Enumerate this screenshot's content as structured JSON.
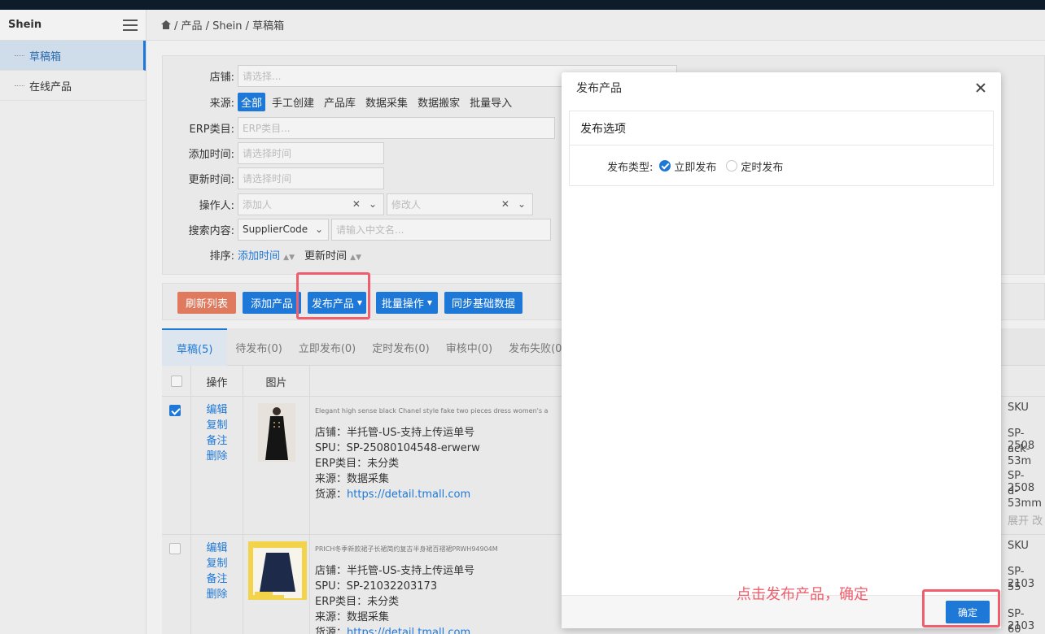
{
  "sidebar": {
    "title": "Shein",
    "items": [
      {
        "label": "草稿箱"
      },
      {
        "label": "在线产品"
      }
    ]
  },
  "breadcrumb": {
    "path": "/ 产品 / Shein / 草稿箱"
  },
  "filters": {
    "store_label": "店铺:",
    "store_placeholder": "请选择...",
    "source_label": "来源:",
    "sources": [
      "全部",
      "手工创建",
      "产品库",
      "数据采集",
      "数据搬家",
      "批量导入"
    ],
    "erp_label": "ERP类目:",
    "erp_placeholder": "ERP类目...",
    "added_label": "添加时间:",
    "added_placeholder": "请选择时间",
    "updated_label": "更新时间:",
    "updated_placeholder": "请选择时间",
    "operator_label": "操作人:",
    "adder_placeholder": "添加人",
    "modifier_placeholder": "修改人",
    "search_label": "搜索内容:",
    "search_type": "SupplierCode",
    "search_placeholder": "请输入中文名...",
    "sort_label": "排序:",
    "sort_added": "添加时间",
    "sort_updated": "更新时间"
  },
  "toolbar": {
    "refresh": "刷新列表",
    "add": "添加产品",
    "publish": "发布产品",
    "batch": "批量操作",
    "sync": "同步基础数据"
  },
  "tabs": [
    "草稿(5)",
    "待发布(0)",
    "立即发布(0)",
    "定时发布(0)",
    "审核中(0)",
    "发布失败(0)"
  ],
  "table": {
    "headers": {
      "ops": "操作",
      "image": "图片"
    },
    "ops": [
      "编辑",
      "复制",
      "备注",
      "删除"
    ],
    "rows": [
      {
        "title": "Elegant high sense black Chanel style fake two pieces dress women's a",
        "store": "店铺：半托管-US-支持上传运单号",
        "spu": "SPU：SP-25080104548-erwerw",
        "erp": "ERP类目：未分类",
        "source": "来源：数据采集",
        "supply_label": "货源：",
        "supply_link": "https://detail.tmall.com",
        "right": [
          "SKU",
          "SP-2508",
          "ack-53m",
          "SP-2508",
          "d-53mm",
          "展开 改"
        ]
      },
      {
        "title": "PRICH冬季新款裙子长裙简约复古半身裙百褶裙PRWH94904M",
        "store": "店铺：半托管-US-支持上传运单号",
        "spu": "SPU：SP-21032203173",
        "erp": "ERP类目：未分类",
        "source": "来源：数据采集",
        "supply_label": "货源：",
        "supply_link": "https://detail.tmall.com",
        "right": [
          "SKU",
          "SP-2103",
          "55",
          "SP-2103",
          "60"
        ]
      }
    ]
  },
  "modal": {
    "title": "发布产品",
    "section_title": "发布选项",
    "type_label": "发布类型:",
    "option_now": "立即发布",
    "option_scheduled": "定时发布",
    "confirm": "确定"
  },
  "annotation": "点击发布产品，确定",
  "colors": {
    "accent": "#1e78d7",
    "highlight": "#f05d6c",
    "refresh": "#e07a5f"
  }
}
